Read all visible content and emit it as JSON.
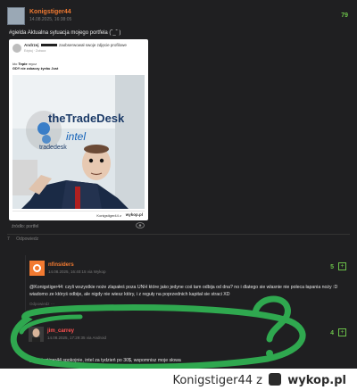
{
  "post": {
    "author": "Konigstiger44",
    "date": "14.08.2025, 16:38:05",
    "votes": "79",
    "tag": "#gielda",
    "text": "Aktualna sytuacja mojego portfela (˘_˘ )",
    "source": "źródło: portfel",
    "actions": [
      "7",
      "Odpowiedz"
    ]
  },
  "embed": {
    "name": "Andrzej",
    "after_name": "zaobserwował swoje zdjęcie profilowe",
    "sub": "Edytuj · Zobacz",
    "line1_who": "kto",
    "line1_bold": "Teple",
    "line1_rest": "mycz",
    "line2": "GDY nie zobaczy żyebu Just",
    "meme_logo": "theTradeDesk",
    "meme_brand": "intel",
    "meme_sub": "tradedesk",
    "footer_user": "Konigstiger44 z",
    "footer_brand": "wykop.pl"
  },
  "reply1": {
    "author": "nfinsiders",
    "date": "14.08.2025, 16:40:15 via Wykop",
    "votes": "5",
    "plus": "+",
    "text": "@Konigstiger44: czyli wszystkie noże zlapałeś poza UNH które jako jedyne coś tam odbija od dna? no i dlatego sie wlasnie nie poleca łapania noży :D wiadomo ze któryś odbije, ale nigdy nie wiesz który, i z reguły na poprzednich kapitał sie straci XD",
    "actions": "Odpowiedz   ···"
  },
  "reply2": {
    "author": "jim_carrey",
    "date": "14.08.2025, 17:29:35 via Android",
    "votes": "4",
    "plus": "+",
    "text": "@Konigstiger44 spokojnie, intel za tydzień po 30$, wspomnisz moje słowa"
  },
  "overlay": {
    "annotation_color": "#2fa84f",
    "question_mark": "?"
  },
  "footer": {
    "user": "Konigstiger44",
    "z": "z",
    "brand": "wykop.pl"
  }
}
